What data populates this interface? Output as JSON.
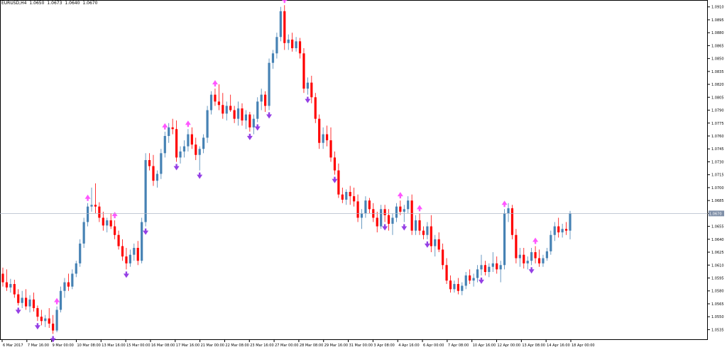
{
  "header": {
    "symbol": "EURUSD,H4",
    "open": "1.0650",
    "high": "1.0673",
    "low": "1.0640",
    "close": "1.0670"
  },
  "colors": {
    "bull": "#4682b4",
    "bear": "#ff0000",
    "current_line": "#b0b8c8",
    "price_tag_bg": "#8090a8",
    "arrow_up": "#ff44ff",
    "arrow_down": "#8a2be2"
  },
  "chart_data": {
    "type": "candlestick",
    "ylim": [
      1.0523,
      1.0918
    ],
    "current_price": "1.0670",
    "y_ticks": [
      "1.0910",
      "1.0895",
      "1.0880",
      "1.0865",
      "1.0850",
      "1.0835",
      "1.0820",
      "1.0805",
      "1.0790",
      "1.0775",
      "1.0760",
      "1.0745",
      "1.0730",
      "1.0715",
      "1.0700",
      "1.0685",
      "1.0670",
      "1.0655",
      "1.0640",
      "1.0625",
      "1.0610",
      "1.0595",
      "1.0580",
      "1.0565",
      "1.0550",
      "1.0535"
    ],
    "x_ticks": [
      "6 Mar 2017",
      "7 Mar 16:00",
      "9 Mar 00:00",
      "10 Mar 08:00",
      "13 Mar 16:00",
      "15 Mar 00:00",
      "16 Mar 08:00",
      "17 Mar 16:00",
      "21 Mar 00:00",
      "22 Mar 08:00",
      "23 Mar 16:00",
      "27 Mar 00:00",
      "28 Mar 08:00",
      "29 Mar 16:00",
      "31 Mar 00:00",
      "3 Apr 08:00",
      "4 Apr 16:00",
      "6 Apr 00:00",
      "7 Apr 08:00",
      "10 Apr 16:00",
      "12 Apr 00:00",
      "13 Apr 08:00",
      "14 Apr 16:00",
      "18 Apr 00:00"
    ],
    "candles": [
      [
        1.06,
        1.0607,
        1.0585,
        1.059
      ],
      [
        1.059,
        1.0605,
        1.058,
        1.0584
      ],
      [
        1.0584,
        1.0594,
        1.0578,
        1.0588
      ],
      [
        1.0588,
        1.0593,
        1.0572,
        1.0576
      ],
      [
        1.0576,
        1.0582,
        1.0563,
        1.0566
      ],
      [
        1.0566,
        1.058,
        1.056,
        1.0572
      ],
      [
        1.0572,
        1.0582,
        1.0558,
        1.0562
      ],
      [
        1.0562,
        1.0575,
        1.0555,
        1.057
      ],
      [
        1.057,
        1.0578,
        1.0556,
        1.056
      ],
      [
        1.056,
        1.0563,
        1.0545,
        1.055
      ],
      [
        1.055,
        1.0558,
        1.054,
        1.0545
      ],
      [
        1.0545,
        1.0552,
        1.0538,
        1.0548
      ],
      [
        1.0548,
        1.056,
        1.0537,
        1.0542
      ],
      [
        1.0542,
        1.0552,
        1.053,
        1.0534
      ],
      [
        1.0534,
        1.0562,
        1.0532,
        1.0558
      ],
      [
        1.0558,
        1.0585,
        1.0555,
        1.058
      ],
      [
        1.058,
        1.0595,
        1.0572,
        1.059
      ],
      [
        1.059,
        1.06,
        1.058,
        1.0585
      ],
      [
        1.0585,
        1.0605,
        1.0582,
        1.06
      ],
      [
        1.06,
        1.0615,
        1.0596,
        1.0612
      ],
      [
        1.0612,
        1.064,
        1.0608,
        1.0635
      ],
      [
        1.0635,
        1.0665,
        1.063,
        1.066
      ],
      [
        1.066,
        1.0682,
        1.0655,
        1.0678
      ],
      [
        1.0678,
        1.07,
        1.0672,
        1.068
      ],
      [
        1.068,
        1.0705,
        1.067,
        1.0678
      ],
      [
        1.0678,
        1.0683,
        1.066,
        1.0665
      ],
      [
        1.0665,
        1.0672,
        1.065,
        1.0656
      ],
      [
        1.0656,
        1.0665,
        1.0648,
        1.0662
      ],
      [
        1.0662,
        1.067,
        1.0652,
        1.0655
      ],
      [
        1.0655,
        1.0662,
        1.064,
        1.0645
      ],
      [
        1.0645,
        1.065,
        1.0628,
        1.0632
      ],
      [
        1.0632,
        1.064,
        1.0615,
        1.062
      ],
      [
        1.062,
        1.063,
        1.0605,
        1.0612
      ],
      [
        1.0612,
        1.0628,
        1.0608,
        1.0622
      ],
      [
        1.0622,
        1.0635,
        1.0615,
        1.063
      ],
      [
        1.063,
        1.0638,
        1.061,
        1.0615
      ],
      [
        1.0615,
        1.0665,
        1.0612,
        1.066
      ],
      [
        1.066,
        1.074,
        1.0655,
        1.0732
      ],
      [
        1.0732,
        1.074,
        1.072,
        1.0725
      ],
      [
        1.0725,
        1.0738,
        1.0702,
        1.0708
      ],
      [
        1.0708,
        1.072,
        1.07,
        1.0716
      ],
      [
        1.0716,
        1.0745,
        1.071,
        1.074
      ],
      [
        1.074,
        1.0765,
        1.0735,
        1.076
      ],
      [
        1.076,
        1.0775,
        1.0752,
        1.077
      ],
      [
        1.077,
        1.078,
        1.0762,
        1.0768
      ],
      [
        1.0768,
        1.0778,
        1.073,
        1.0735
      ],
      [
        1.0735,
        1.0748,
        1.0728,
        1.0742
      ],
      [
        1.0742,
        1.0755,
        1.0735,
        1.0748
      ],
      [
        1.0748,
        1.0768,
        1.0742,
        1.0762
      ],
      [
        1.0762,
        1.077,
        1.0745,
        1.075
      ],
      [
        1.075,
        1.0758,
        1.0732,
        1.0738
      ],
      [
        1.0738,
        1.0748,
        1.072,
        1.0745
      ],
      [
        1.0745,
        1.0762,
        1.074,
        1.0758
      ],
      [
        1.0758,
        1.0795,
        1.0752,
        1.079
      ],
      [
        1.079,
        1.0812,
        1.0785,
        1.0808
      ],
      [
        1.0808,
        1.0815,
        1.0795,
        1.08
      ],
      [
        1.08,
        1.082,
        1.079,
        1.0796
      ],
      [
        1.0796,
        1.081,
        1.078,
        1.0786
      ],
      [
        1.0786,
        1.08,
        1.0778,
        1.0795
      ],
      [
        1.0795,
        1.0808,
        1.0788,
        1.079
      ],
      [
        1.079,
        1.0795,
        1.0775,
        1.078
      ],
      [
        1.078,
        1.08,
        1.0772,
        1.0792
      ],
      [
        1.0792,
        1.0798,
        1.0772,
        1.0778
      ],
      [
        1.0778,
        1.079,
        1.0768,
        1.0785
      ],
      [
        1.0785,
        1.0788,
        1.0765,
        1.077
      ],
      [
        1.077,
        1.0785,
        1.0762,
        1.078
      ],
      [
        1.078,
        1.0805,
        1.0776,
        1.08
      ],
      [
        1.08,
        1.0815,
        1.079,
        1.0808
      ],
      [
        1.0808,
        1.0812,
        1.0788,
        1.0795
      ],
      [
        1.0795,
        1.085,
        1.079,
        1.0845
      ],
      [
        1.0845,
        1.086,
        1.0838,
        1.0856
      ],
      [
        1.0856,
        1.088,
        1.085,
        1.0875
      ],
      [
        1.0875,
        1.091,
        1.087,
        1.0905
      ],
      [
        1.0905,
        1.0912,
        1.086,
        1.0868
      ],
      [
        1.0868,
        1.0878,
        1.086,
        1.0872
      ],
      [
        1.0872,
        1.088,
        1.0858,
        1.0862
      ],
      [
        1.0862,
        1.0875,
        1.0858,
        1.087
      ],
      [
        1.087,
        1.0874,
        1.085,
        1.0856
      ],
      [
        1.0856,
        1.0862,
        1.081,
        1.0815
      ],
      [
        1.0815,
        1.0828,
        1.0808,
        1.0822
      ],
      [
        1.0822,
        1.083,
        1.0798,
        1.0805
      ],
      [
        1.0805,
        1.081,
        1.0775,
        1.078
      ],
      [
        1.078,
        1.0785,
        1.0745,
        1.0752
      ],
      [
        1.0752,
        1.077,
        1.0745,
        1.0762
      ],
      [
        1.0762,
        1.0772,
        1.0748,
        1.0755
      ],
      [
        1.0755,
        1.077,
        1.073,
        1.0735
      ],
      [
        1.0735,
        1.0742,
        1.0715,
        1.072
      ],
      [
        1.072,
        1.0728,
        1.0688,
        1.0692
      ],
      [
        1.0692,
        1.07,
        1.0682,
        1.0686
      ],
      [
        1.0686,
        1.0698,
        1.068,
        1.0695
      ],
      [
        1.0695,
        1.0702,
        1.068,
        1.069
      ],
      [
        1.069,
        1.07,
        1.0678,
        1.0684
      ],
      [
        1.0684,
        1.0692,
        1.066,
        1.0665
      ],
      [
        1.0665,
        1.0675,
        1.0652,
        1.067
      ],
      [
        1.067,
        1.069,
        1.0665,
        1.0685
      ],
      [
        1.0685,
        1.0688,
        1.067,
        1.0675
      ],
      [
        1.0675,
        1.0682,
        1.066,
        1.0665
      ],
      [
        1.0665,
        1.0672,
        1.0648,
        1.0655
      ],
      [
        1.0655,
        1.068,
        1.0652,
        1.0675
      ],
      [
        1.0675,
        1.068,
        1.066,
        1.0668
      ],
      [
        1.0668,
        1.0675,
        1.065,
        1.0658
      ],
      [
        1.0658,
        1.067,
        1.0645,
        1.0665
      ],
      [
        1.0665,
        1.0682,
        1.066,
        1.0678
      ],
      [
        1.0678,
        1.0685,
        1.0668,
        1.0672
      ],
      [
        1.0672,
        1.068,
        1.066,
        1.0675
      ],
      [
        1.0675,
        1.069,
        1.067,
        1.0685
      ],
      [
        1.0685,
        1.0692,
        1.0645,
        1.065
      ],
      [
        1.065,
        1.0668,
        1.0645,
        1.0662
      ],
      [
        1.0662,
        1.067,
        1.0645,
        1.065
      ],
      [
        1.065,
        1.0655,
        1.064,
        1.0645
      ],
      [
        1.0645,
        1.066,
        1.064,
        1.0655
      ],
      [
        1.0655,
        1.0668,
        1.0625,
        1.0632
      ],
      [
        1.0632,
        1.0645,
        1.062,
        1.064
      ],
      [
        1.064,
        1.0648,
        1.0625,
        1.0628
      ],
      [
        1.0628,
        1.0635,
        1.0605,
        1.061
      ],
      [
        1.061,
        1.0618,
        1.0588,
        1.0592
      ],
      [
        1.0592,
        1.0598,
        1.0578,
        1.0582
      ],
      [
        1.0582,
        1.0592,
        1.0578,
        1.0588
      ],
      [
        1.0588,
        1.0595,
        1.0576,
        1.058
      ],
      [
        1.058,
        1.059,
        1.0575,
        1.0586
      ],
      [
        1.0586,
        1.0602,
        1.0582,
        1.0598
      ],
      [
        1.0598,
        1.0605,
        1.0588,
        1.0592
      ],
      [
        1.0592,
        1.06,
        1.0585,
        1.0595
      ],
      [
        1.0595,
        1.061,
        1.059,
        1.0605
      ],
      [
        1.0605,
        1.0622,
        1.0598,
        1.061
      ],
      [
        1.061,
        1.0615,
        1.0598,
        1.0602
      ],
      [
        1.0602,
        1.0612,
        1.0596,
        1.0608
      ],
      [
        1.0608,
        1.0625,
        1.0602,
        1.0612
      ],
      [
        1.0612,
        1.062,
        1.06,
        1.0605
      ],
      [
        1.0605,
        1.0615,
        1.059,
        1.061
      ],
      [
        1.061,
        1.0675,
        1.0605,
        1.067
      ],
      [
        1.067,
        1.0682,
        1.066,
        1.0676
      ],
      [
        1.0676,
        1.068,
        1.064,
        1.0645
      ],
      [
        1.0645,
        1.0652,
        1.0612,
        1.0618
      ],
      [
        1.0618,
        1.063,
        1.0608,
        1.0622
      ],
      [
        1.0622,
        1.063,
        1.0606,
        1.0612
      ],
      [
        1.0612,
        1.062,
        1.0605,
        1.0615
      ],
      [
        1.0615,
        1.063,
        1.061,
        1.0625
      ],
      [
        1.0625,
        1.0632,
        1.0612,
        1.0618
      ],
      [
        1.0618,
        1.0628,
        1.0608,
        1.0612
      ],
      [
        1.0612,
        1.0622,
        1.0608,
        1.0618
      ],
      [
        1.0618,
        1.063,
        1.0615,
        1.0626
      ],
      [
        1.0626,
        1.065,
        1.0622,
        1.0645
      ],
      [
        1.0645,
        1.066,
        1.0638,
        1.0655
      ],
      [
        1.0655,
        1.0665,
        1.0642,
        1.0648
      ],
      [
        1.0648,
        1.0658,
        1.0642,
        1.0652
      ],
      [
        1.0652,
        1.066,
        1.0645,
        1.065
      ],
      [
        1.065,
        1.0673,
        1.064,
        1.067
      ]
    ],
    "arrows": [
      {
        "i": 14,
        "dir": "up"
      },
      {
        "i": 22,
        "dir": "up"
      },
      {
        "i": 29,
        "dir": "up"
      },
      {
        "i": 42,
        "dir": "up"
      },
      {
        "i": 48,
        "dir": "up"
      },
      {
        "i": 55,
        "dir": "up"
      },
      {
        "i": 73,
        "dir": "up"
      },
      {
        "i": 103,
        "dir": "up"
      },
      {
        "i": 108,
        "dir": "up"
      },
      {
        "i": 130,
        "dir": "up"
      },
      {
        "i": 138,
        "dir": "up"
      },
      {
        "i": 4,
        "dir": "down"
      },
      {
        "i": 9,
        "dir": "down"
      },
      {
        "i": 13,
        "dir": "down"
      },
      {
        "i": 32,
        "dir": "down"
      },
      {
        "i": 37,
        "dir": "down"
      },
      {
        "i": 45,
        "dir": "down"
      },
      {
        "i": 51,
        "dir": "down"
      },
      {
        "i": 64,
        "dir": "down"
      },
      {
        "i": 66,
        "dir": "down"
      },
      {
        "i": 69,
        "dir": "down"
      },
      {
        "i": 79,
        "dir": "down"
      },
      {
        "i": 86,
        "dir": "down"
      },
      {
        "i": 99,
        "dir": "down"
      },
      {
        "i": 104,
        "dir": "down"
      },
      {
        "i": 110,
        "dir": "down"
      },
      {
        "i": 124,
        "dir": "down"
      },
      {
        "i": 137,
        "dir": "down"
      }
    ]
  }
}
